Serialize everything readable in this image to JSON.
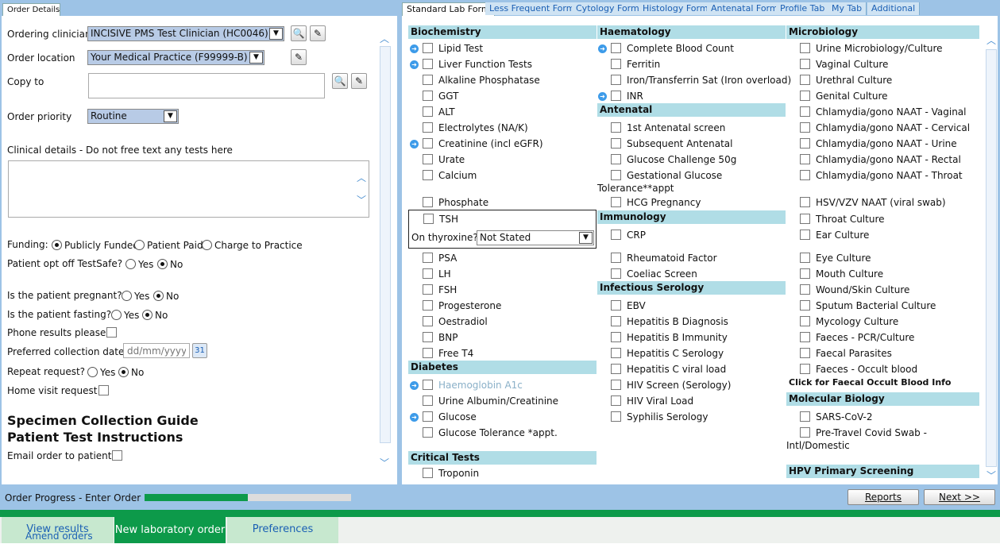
{
  "left_panel": {
    "tab": "Order Details",
    "ordering_clinician": {
      "label": "Ordering clinician",
      "value": "INCISIVE PMS Test Clinician (HC0046)"
    },
    "order_location": {
      "label": "Order location",
      "value": "Your Medical Practice (F99999-B)"
    },
    "copy_to": {
      "label": "Copy to",
      "value": ""
    },
    "order_priority": {
      "label": "Order priority",
      "value": "Routine"
    },
    "clinical_details": {
      "label": "Clinical details - Do not free text any tests here",
      "value": ""
    },
    "funding": {
      "label": "Funding:",
      "options": [
        "Publicly Funded",
        "Patient Paid",
        "Charge to Practice"
      ],
      "selected": "Publicly Funded"
    },
    "opt_off": {
      "label": "Patient opt off TestSafe?",
      "yes": "Yes",
      "no": "No",
      "selected": "No"
    },
    "pregnant": {
      "label": "Is the patient pregnant?",
      "yes": "Yes",
      "no": "No",
      "selected": "No"
    },
    "fasting": {
      "label": "Is the patient fasting?",
      "yes": "Yes",
      "no": "No",
      "selected": "No"
    },
    "phone_results": {
      "label": "Phone results please",
      "checked": false
    },
    "collection_date": {
      "label": "Preferred collection date?",
      "placeholder": "dd/mm/yyyy"
    },
    "repeat_request": {
      "label": "Repeat request?",
      "yes": "Yes",
      "no": "No",
      "selected": "No"
    },
    "home_visit": {
      "label": "Home visit request",
      "checked": false
    },
    "link_specimen": "Specimen Collection Guide",
    "link_instructions": "Patient Test Instructions",
    "email_order": {
      "label": "Email order to patient",
      "checked": false
    }
  },
  "right_panel": {
    "tabs": [
      "Standard Lab Form",
      "Less Frequent Form",
      "Cytology Form",
      "Histology Form",
      "Antenatal Form",
      "Profile Tab",
      "My Tab",
      "Additional"
    ],
    "active_tab": "Standard Lab Form",
    "sections": {
      "biochemistry": "Biochemistry",
      "haematology": "Haematology",
      "microbiology": "Microbiology",
      "antenatal": "Antenatal",
      "immunology": "Immunology",
      "infectious": "Infectious Serology",
      "diabetes": "Diabetes",
      "critical": "Critical Tests",
      "molecular": "Molecular Biology",
      "hpv": "HPV Primary Screening"
    },
    "biochemistry": [
      "Lipid Test",
      "Liver Function Tests",
      "Alkaline Phosphatase",
      "GGT",
      "ALT",
      "Electrolytes (NA/K)",
      "Creatinine (incl eGFR)",
      "Urate",
      "Calcium",
      "Phosphate",
      "TSH",
      "PSA",
      "LH",
      "FSH",
      "Progesterone",
      "Oestradiol",
      "BNP",
      "Free T4"
    ],
    "thyroxine": {
      "label": "On thyroxine?",
      "value": "Not Stated"
    },
    "diabetes": [
      "Haemoglobin A1c",
      "Urine Albumin/Creatinine",
      "Glucose",
      "Glucose Tolerance *appt."
    ],
    "critical": [
      "Troponin"
    ],
    "haematology": [
      "Complete Blood Count",
      "Ferritin",
      "Iron/Transferrin Sat (Iron overload)",
      "INR"
    ],
    "antenatal": [
      "1st Antenatal screen",
      "Subsequent Antenatal",
      "Glucose Challenge 50g",
      "Gestational Glucose",
      "HCG Pregnancy"
    ],
    "antenatal_wrap": "Tolerance**appt",
    "immunology": [
      "CRP",
      "Rheumatoid Factor",
      "Coeliac Screen"
    ],
    "infectious": [
      "EBV",
      "Hepatitis B Diagnosis",
      "Hepatitis B Immunity",
      "Hepatitis C Serology",
      "Hepatitis C viral load",
      "HIV Screen (Serology)",
      "HIV Viral Load",
      "Syphilis Serology"
    ],
    "microbiology": [
      "Urine Microbiology/Culture",
      "Vaginal Culture",
      "Urethral Culture",
      "Genital Culture",
      "Chlamydia/gono NAAT - Vaginal",
      "Chlamydia/gono NAAT - Cervical",
      "Chlamydia/gono NAAT - Urine",
      "Chlamydia/gono NAAT - Rectal",
      "Chlamydia/gono NAAT - Throat",
      "HSV/VZV NAAT (viral swab)",
      "Throat Culture",
      "Ear Culture",
      "Eye Culture",
      "Mouth Culture",
      "Wound/Skin Culture",
      "Sputum Bacterial Culture",
      "Mycology Culture",
      "Faeces - PCR/Culture",
      "Faecal Parasites",
      "Faeces - Occult blood"
    ],
    "faecal_info": "Click for Faecal Occult Blood Info",
    "molecular": [
      "SARS-CoV-2",
      "Pre-Travel Covid Swab -"
    ],
    "molecular_wrap": "Intl/Domestic"
  },
  "footer": {
    "progress_label": "Order Progress - Enter Order",
    "progress": 0.5,
    "reports": "Reports",
    "next": "Next >>"
  },
  "bottom_tabs": {
    "view_results": "View results",
    "amend_orders": "Amend orders",
    "new_order": "New laboratory order",
    "preferences": "Preferences"
  },
  "colors": {
    "panel_blue": "#9dc3e6",
    "section_bg": "#b0dde6",
    "tab_green": "#c7e8cf",
    "active_green": "#0d9a4a",
    "progress_green": "#0d9a4a"
  }
}
